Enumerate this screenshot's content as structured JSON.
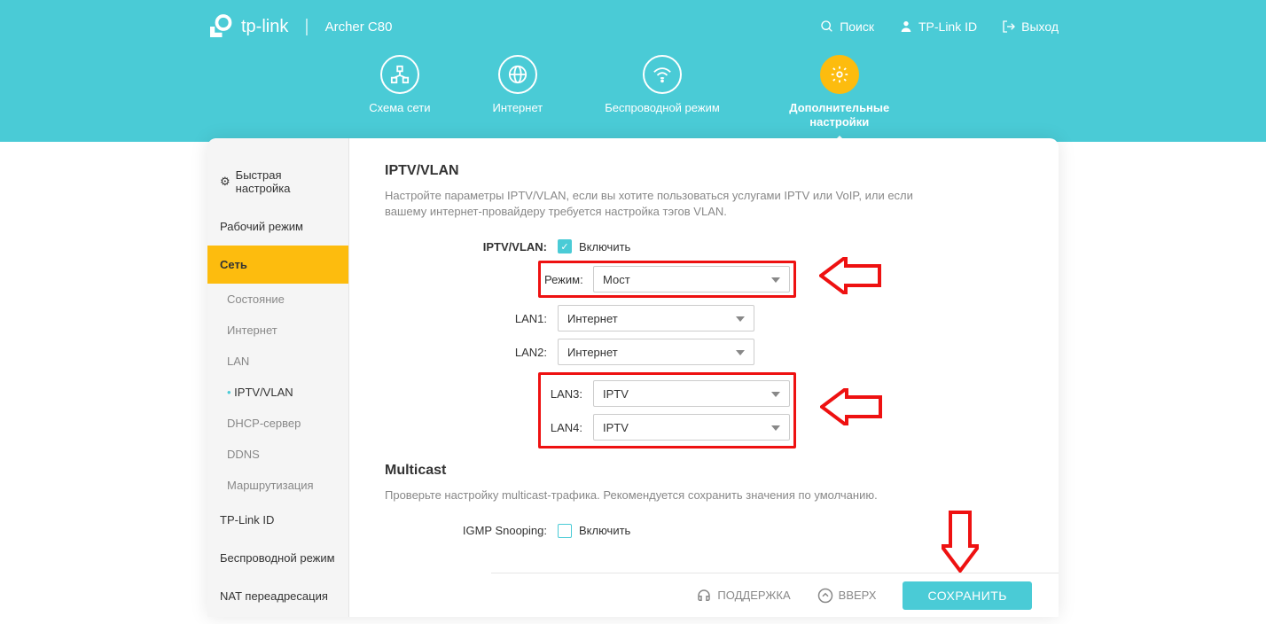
{
  "header": {
    "brand": "tp-link",
    "model": "Archer C80",
    "links": {
      "search": "Поиск",
      "tplinkid": "TP-Link ID",
      "logout": "Выход"
    }
  },
  "tabs": {
    "map": "Схема сети",
    "internet": "Интернет",
    "wireless": "Беспроводной режим",
    "advanced": "Дополнительные настройки"
  },
  "sidebar": {
    "quick": "Быстрая настройка",
    "opmode": "Рабочий режим",
    "network": "Сеть",
    "sub": {
      "status": "Состояние",
      "internet": "Интернет",
      "lan": "LAN",
      "iptv": "IPTV/VLAN",
      "dhcp": "DHCP-сервер",
      "ddns": "DDNS",
      "routing": "Маршрутизация"
    },
    "tplinkid": "TP-Link ID",
    "wireless": "Беспроводной режим",
    "nat": "NAT переадресация"
  },
  "main": {
    "title": "IPTV/VLAN",
    "desc": "Настройте параметры IPTV/VLAN, если вы хотите пользоваться услугами IPTV или VoIP, или если вашему интернет-провайдеру требуется настройка тэгов VLAN.",
    "labels": {
      "iptvvlan": "IPTV/VLAN:",
      "enable": "Включить",
      "mode": "Режим:",
      "lan1": "LAN1:",
      "lan2": "LAN2:",
      "lan3": "LAN3:",
      "lan4": "LAN4:"
    },
    "values": {
      "mode": "Мост",
      "lan1": "Интернет",
      "lan2": "Интернет",
      "lan3": "IPTV",
      "lan4": "IPTV"
    },
    "multicast_title": "Multicast",
    "multicast_desc": "Проверьте настройку multicast-трафика. Рекомендуется сохранить значения по умолчанию.",
    "igmp_label": "IGMP Snooping:",
    "igmp_enable": "Включить"
  },
  "footer": {
    "support": "ПОДДЕРЖКА",
    "top": "ВВЕРХ",
    "save": "СОХРАНИТЬ"
  }
}
